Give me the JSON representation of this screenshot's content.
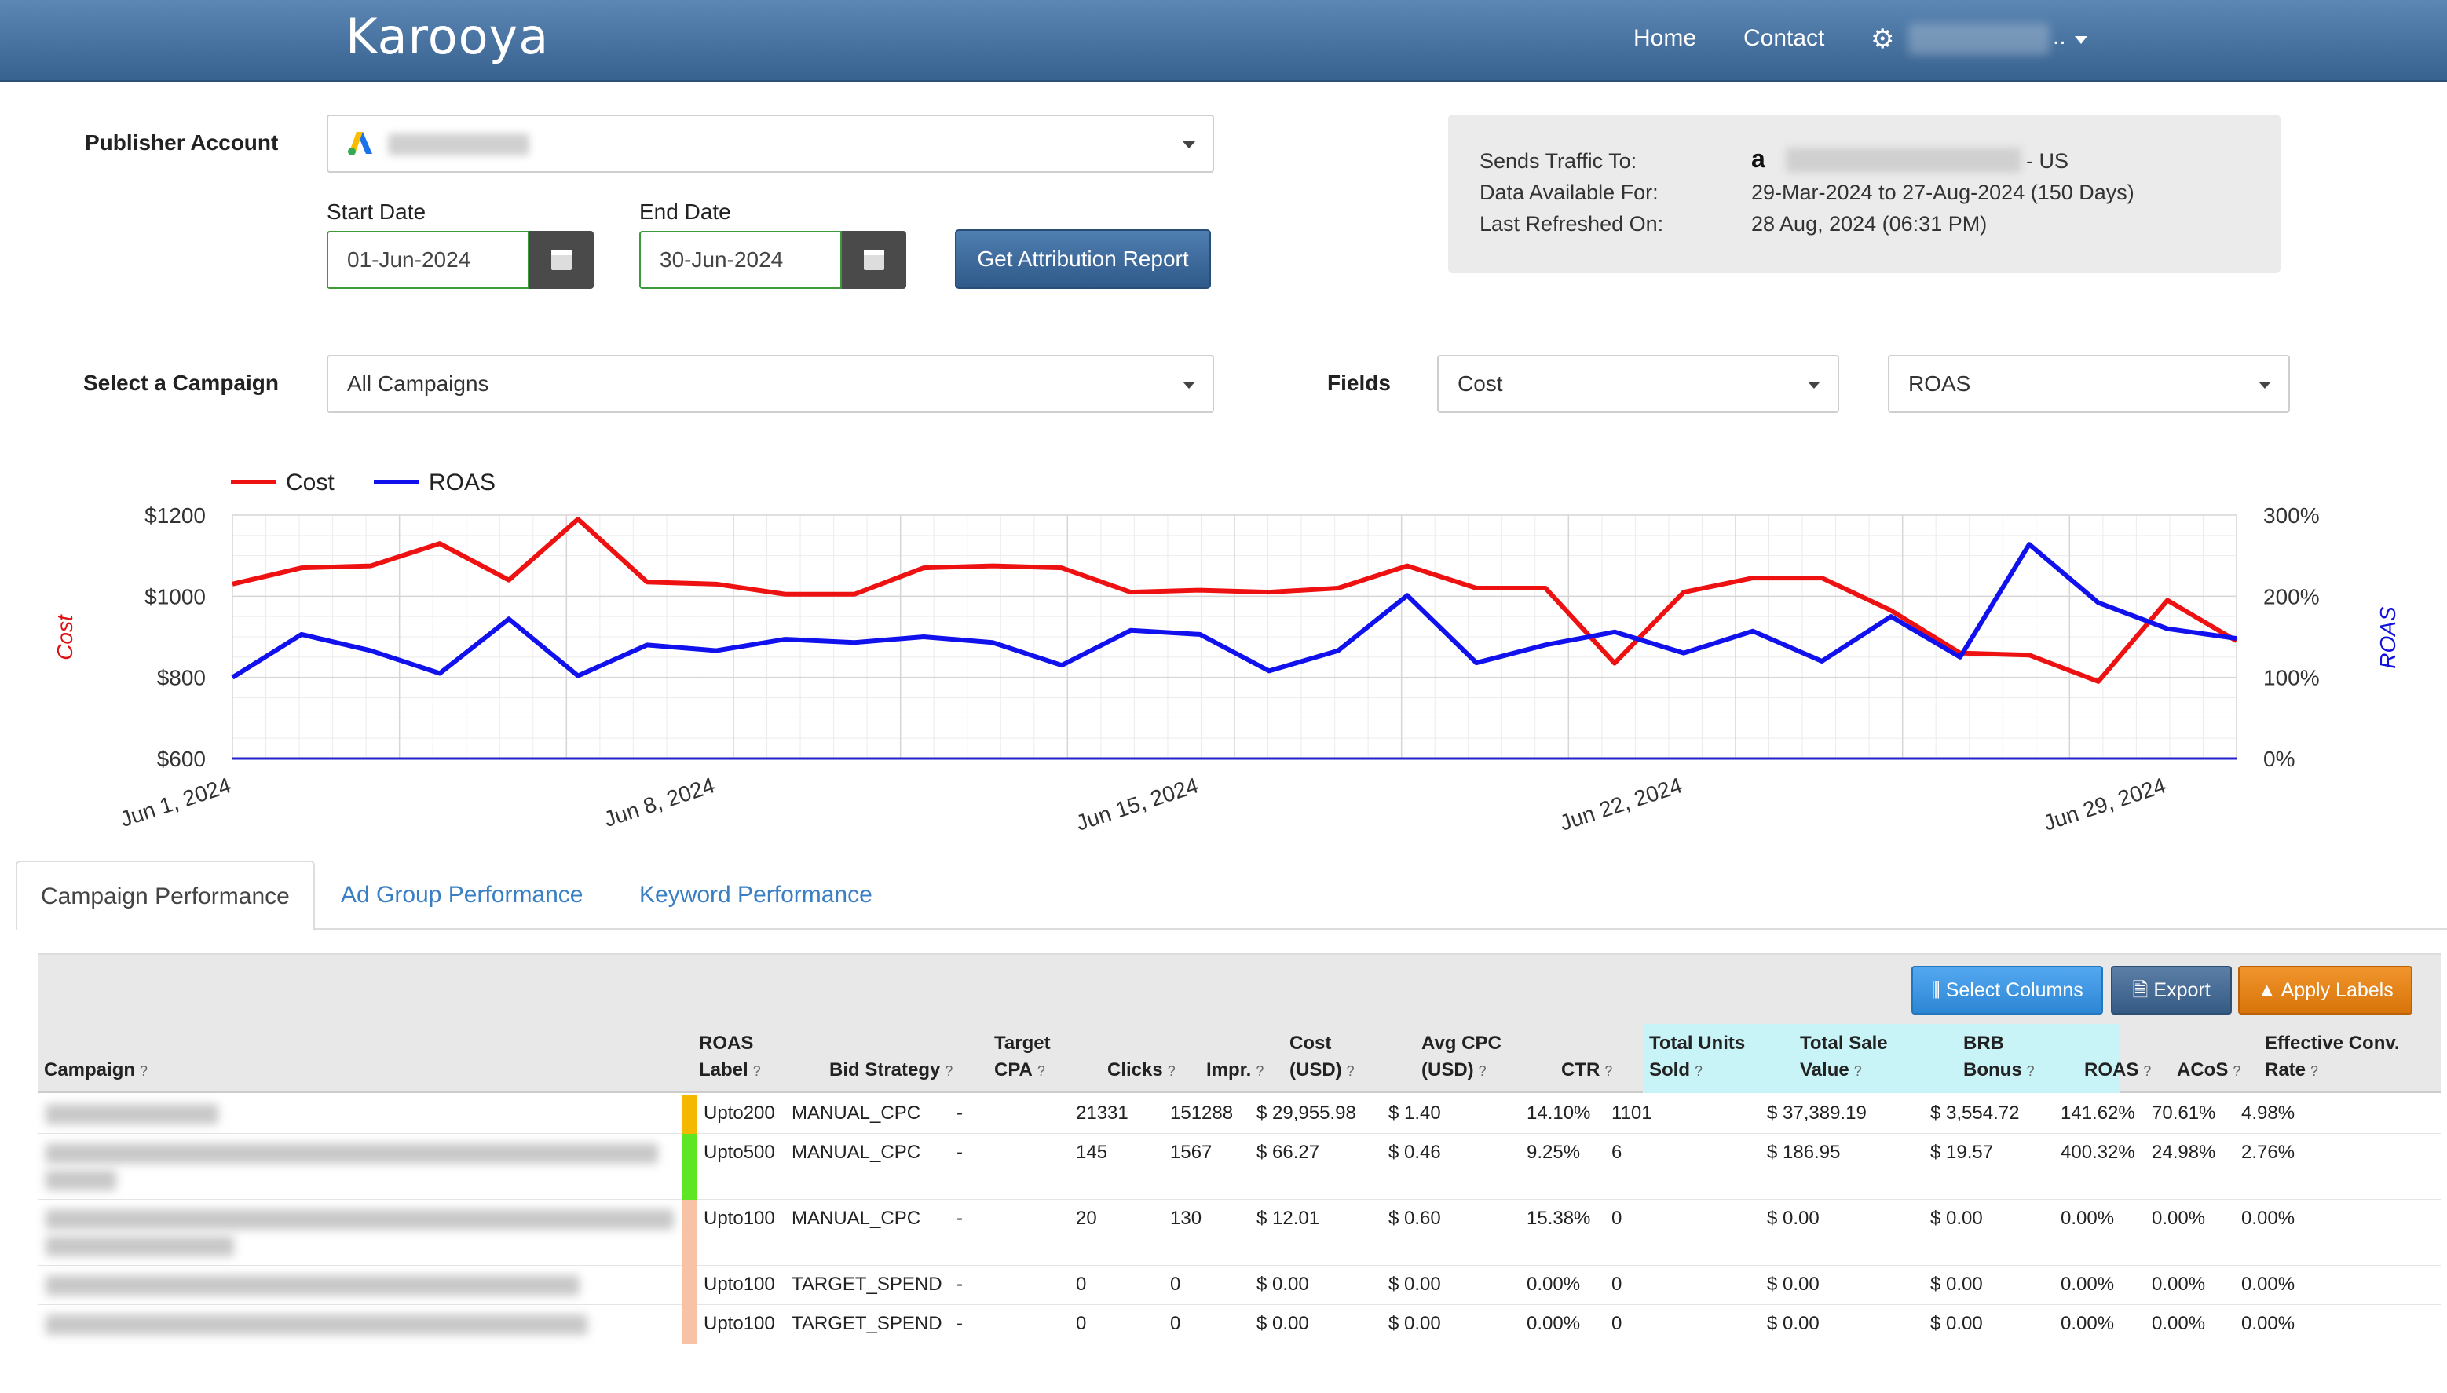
{
  "header": {
    "logo": "Karooya",
    "nav": {
      "home": "Home",
      "contact": "Contact",
      "user_suffix": ".."
    }
  },
  "filters": {
    "publisher_account_label": "Publisher Account",
    "start_date_label": "Start Date",
    "end_date_label": "End Date",
    "start_date": "01-Jun-2024",
    "end_date": "30-Jun-2024",
    "get_report_button": "Get Attribution Report",
    "select_campaign_label": "Select a Campaign",
    "campaign_value": "All Campaigns",
    "fields_label": "Fields",
    "field1_value": "Cost",
    "field2_value": "ROAS"
  },
  "info": {
    "sends_traffic_label": "Sends Traffic To:",
    "sends_traffic_suffix": "- US",
    "data_available_label": "Data Available For:",
    "data_available_value": "29-Mar-2024 to 27-Aug-2024 (150 Days)",
    "last_refreshed_label": "Last Refreshed On:",
    "last_refreshed_value": "28 Aug, 2024 (06:31 PM)"
  },
  "chart_data": {
    "type": "line",
    "legend": [
      "Cost",
      "ROAS"
    ],
    "legend_placement": "top-left",
    "left_axis_label": "Cost",
    "right_axis_label": "ROAS",
    "left_ticks": [
      "$1200",
      "$1000",
      "$800",
      "$600"
    ],
    "right_ticks": [
      "300%",
      "200%",
      "100%",
      "0%"
    ],
    "x_ticks": [
      "Jun 1, 2024",
      "Jun 8, 2024",
      "Jun 15, 2024",
      "Jun 22, 2024",
      "Jun 29, 2024"
    ],
    "ylim_left": [
      600,
      1200
    ],
    "ylim_right": [
      0,
      300
    ],
    "grid": true,
    "x": [
      "Jun 1",
      "Jun 2",
      "Jun 3",
      "Jun 4",
      "Jun 5",
      "Jun 6",
      "Jun 7",
      "Jun 8",
      "Jun 9",
      "Jun 10",
      "Jun 11",
      "Jun 12",
      "Jun 13",
      "Jun 14",
      "Jun 15",
      "Jun 16",
      "Jun 17",
      "Jun 18",
      "Jun 19",
      "Jun 20",
      "Jun 21",
      "Jun 22",
      "Jun 23",
      "Jun 24",
      "Jun 25",
      "Jun 26",
      "Jun 27",
      "Jun 28",
      "Jun 29",
      "Jun 30"
    ],
    "series": [
      {
        "name": "Cost",
        "color": "#ee1111",
        "values": [
          1030,
          1070,
          1075,
          1130,
          1040,
          1190,
          1035,
          1030,
          1005,
          1005,
          1070,
          1075,
          1070,
          1010,
          1015,
          1010,
          1020,
          1075,
          1020,
          1020,
          835,
          1010,
          1045,
          1045,
          965,
          860,
          855,
          790,
          990,
          890
        ]
      },
      {
        "name": "ROAS",
        "color": "#1111ee",
        "values": [
          100,
          153,
          133,
          105,
          172,
          102,
          140,
          133,
          147,
          143,
          150,
          143,
          115,
          158,
          153,
          108,
          133,
          201,
          118,
          140,
          156,
          130,
          157,
          120,
          175,
          125,
          264,
          192,
          160,
          148
        ]
      }
    ]
  },
  "tabs": [
    "Campaign Performance",
    "Ad Group Performance",
    "Keyword Performance"
  ],
  "toolbar": {
    "select_columns": "Select Columns",
    "export": "Export",
    "apply_labels": "Apply Labels"
  },
  "table": {
    "headers": {
      "campaign": "Campaign",
      "roas_label_1": "ROAS",
      "roas_label_2": "Label",
      "bid_strategy": "Bid Strategy",
      "target_cpa_1": "Target",
      "target_cpa_2": "CPA",
      "clicks": "Clicks",
      "impr": "Impr.",
      "cost_1": "Cost",
      "cost_2": "(USD)",
      "avg_cpc_1": "Avg CPC",
      "avg_cpc_2": "(USD)",
      "ctr": "CTR",
      "units_1": "Total Units",
      "units_2": "Sold",
      "sale_1": "Total Sale",
      "sale_2": "Value",
      "brb_1": "BRB",
      "brb_2": "Bonus",
      "roas": "ROAS",
      "acos": "ACoS",
      "ecr_1": "Effective Conv.",
      "ecr_2": "Rate",
      "help": "?"
    },
    "rows": [
      {
        "label": "Upto200",
        "bid": "MANUAL_CPC",
        "tcpa": "-",
        "clicks": "21331",
        "impr": "151288",
        "cost": "$ 29,955.98",
        "cpc": "$ 1.40",
        "ctr": "14.10%",
        "units": "1101",
        "sale": "$ 37,389.19",
        "brb": "$ 3,554.72",
        "roas": "141.62%",
        "acos": "70.61%",
        "ecr": "4.98%",
        "color": "#f5b800"
      },
      {
        "label": "Upto500",
        "bid": "MANUAL_CPC",
        "tcpa": "-",
        "clicks": "145",
        "impr": "1567",
        "cost": "$ 66.27",
        "cpc": "$ 0.46",
        "ctr": "9.25%",
        "units": "6",
        "sale": "$ 186.95",
        "brb": "$ 19.57",
        "roas": "400.32%",
        "acos": "24.98%",
        "ecr": "2.76%",
        "color": "#5ee626"
      },
      {
        "label": "Upto100",
        "bid": "MANUAL_CPC",
        "tcpa": "-",
        "clicks": "20",
        "impr": "130",
        "cost": "$ 12.01",
        "cpc": "$ 0.60",
        "ctr": "15.38%",
        "units": "0",
        "sale": "$ 0.00",
        "brb": "$ 0.00",
        "roas": "0.00%",
        "acos": "0.00%",
        "ecr": "0.00%",
        "color": "#f6c3a6"
      },
      {
        "label": "Upto100",
        "bid": "TARGET_SPEND",
        "tcpa": "-",
        "clicks": "0",
        "impr": "0",
        "cost": "$ 0.00",
        "cpc": "$ 0.00",
        "ctr": "0.00%",
        "units": "0",
        "sale": "$ 0.00",
        "brb": "$ 0.00",
        "roas": "0.00%",
        "acos": "0.00%",
        "ecr": "0.00%",
        "color": "#f6c3a6"
      },
      {
        "label": "Upto100",
        "bid": "TARGET_SPEND",
        "tcpa": "-",
        "clicks": "0",
        "impr": "0",
        "cost": "$ 0.00",
        "cpc": "$ 0.00",
        "ctr": "0.00%",
        "units": "0",
        "sale": "$ 0.00",
        "brb": "$ 0.00",
        "roas": "0.00%",
        "acos": "0.00%",
        "ecr": "0.00%",
        "color": "#f6c3a6"
      }
    ]
  }
}
